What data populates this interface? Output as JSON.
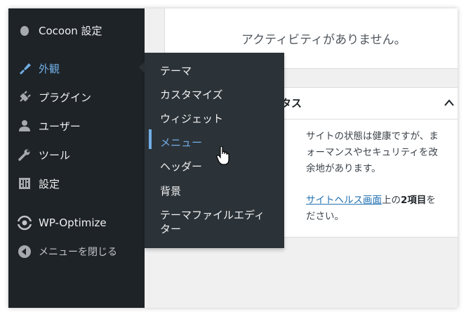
{
  "sidebar": {
    "items": [
      {
        "label": "Cocoon 設定",
        "icon": "cocoon-icon"
      },
      {
        "label": "外観",
        "icon": "brush-icon",
        "state": "current"
      },
      {
        "label": "プラグイン",
        "icon": "plugin-icon"
      },
      {
        "label": "ユーザー",
        "icon": "user-icon"
      },
      {
        "label": "ツール",
        "icon": "wrench-icon"
      },
      {
        "label": "設定",
        "icon": "settings-icon"
      },
      {
        "label": "WP-Optimize",
        "icon": "wp-optimize-icon"
      },
      {
        "label": "メニューを閉じる",
        "icon": "collapse-icon"
      }
    ]
  },
  "flyout": {
    "items": [
      {
        "label": "テーマ"
      },
      {
        "label": "カスタマイズ"
      },
      {
        "label": "ウィジェット"
      },
      {
        "label": "メニュー",
        "state": "active"
      },
      {
        "label": "ヘッダー"
      },
      {
        "label": "背景"
      },
      {
        "label": "テーマファイルエディター",
        "line1": "テーマファイルエディ",
        "line2": "ター"
      }
    ]
  },
  "activity": {
    "empty_text": "アクティビティがありません。"
  },
  "site_health": {
    "title_visible": "タス",
    "body_line1": "サイトの状態は健康ですが、ま",
    "body_line2": "ォーマンスやセキュリティを改",
    "body_line3": "余地があります。",
    "link_text": "サイトヘルス画面",
    "after_link": "上の",
    "strong_text": "2項目",
    "after_strong": "を",
    "body_line5": "ださい。"
  },
  "colors": {
    "sidebar_bg": "#1d2327",
    "flyout_bg": "#2c3338",
    "accent": "#72aee6",
    "link": "#2271b1"
  }
}
